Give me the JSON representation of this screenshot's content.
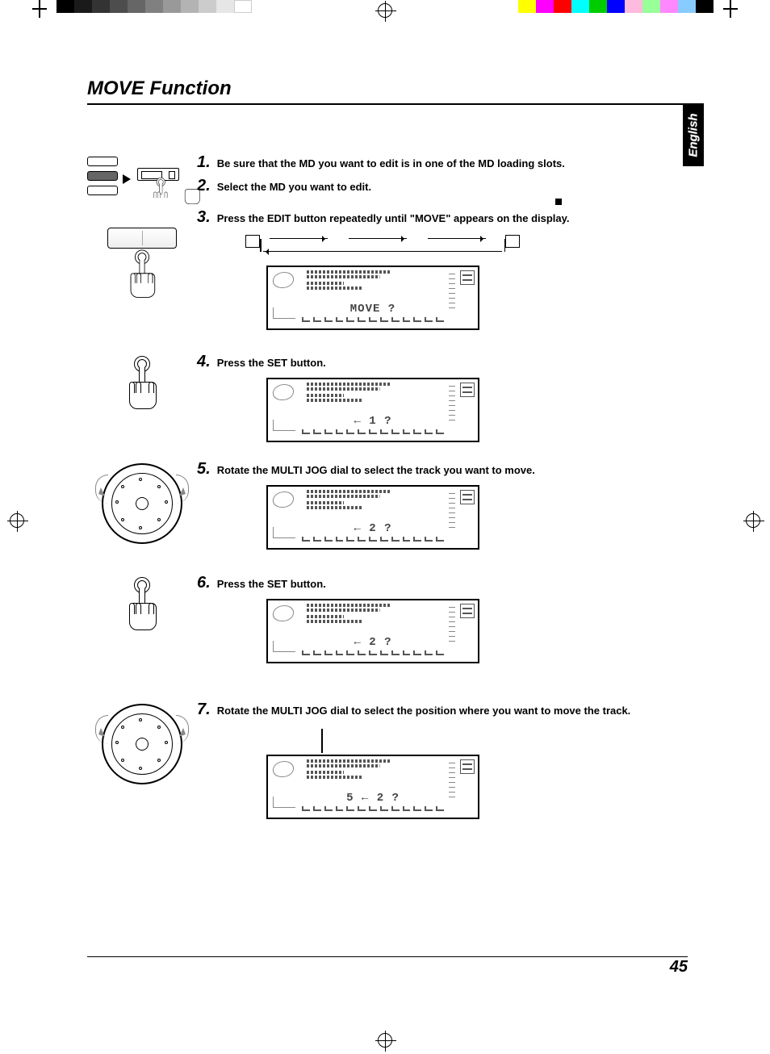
{
  "header": {
    "title": "MOVE Function"
  },
  "language_tab": "English",
  "page_number": "45",
  "steps": [
    {
      "num": "1",
      "text": "Be sure that the MD you want to edit is in one of the MD loading slots."
    },
    {
      "num": "2",
      "text": "Select the MD you want to edit."
    },
    {
      "num": "3",
      "text": "Press the EDIT button repeatedly  until \"MOVE\" appears on the display."
    },
    {
      "num": "4",
      "text": "Press the SET button."
    },
    {
      "num": "5",
      "text": "Rotate the MULTI JOG dial to select the track you want to move."
    },
    {
      "num": "6",
      "text": "Press the SET button."
    },
    {
      "num": "7",
      "text": "Rotate the MULTI JOG dial to select the position where you want to move the track."
    }
  ],
  "display_panels": {
    "step3": "MOVE  ?",
    "step4": "←   1 ?",
    "step5": "←   2 ?",
    "step6": "←   2 ?",
    "step7": "5 ←   2 ?"
  }
}
